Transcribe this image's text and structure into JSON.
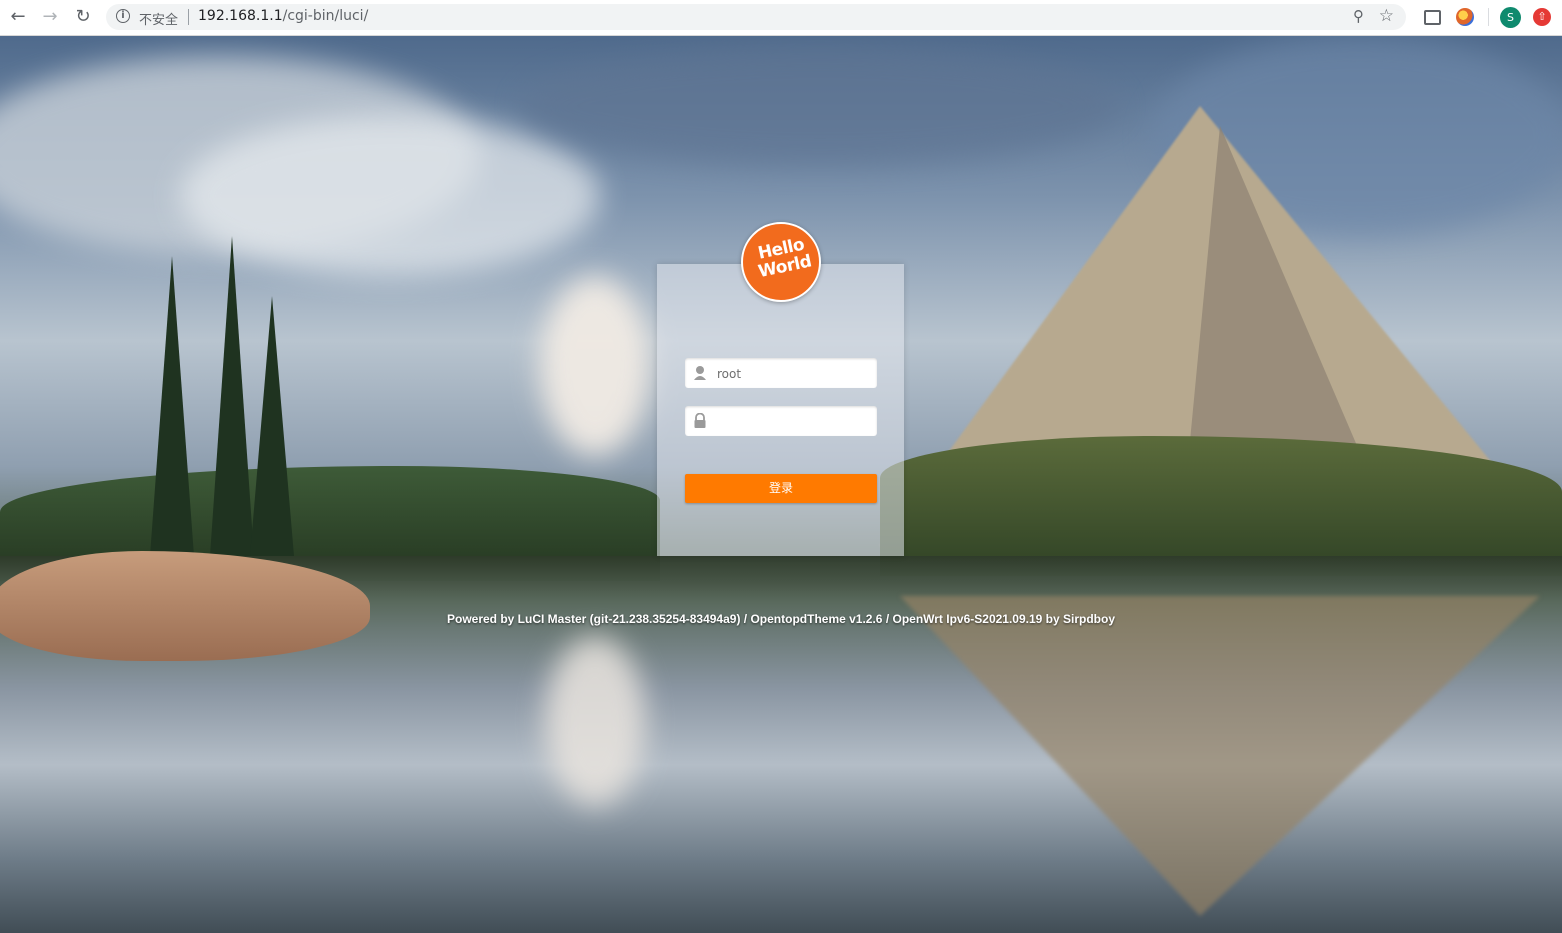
{
  "browser": {
    "security_label": "不安全",
    "url_host": "192.168.1.1",
    "url_path": "/cgi-bin/luci/",
    "profile_initial": "S"
  },
  "icons": {
    "back": "back-arrow-icon",
    "forward": "forward-arrow-icon",
    "reload": "reload-icon",
    "info": "info-icon",
    "zoom": "zoom-icon",
    "star": "bookmark-star-icon"
  },
  "logo": {
    "line1": "Hello",
    "line2": "World"
  },
  "login": {
    "username_value": "root",
    "password_value": "",
    "submit_label": "登录"
  },
  "footer": {
    "text": "Powered by LuCI Master (git-21.238.35254-83494a9) / OpentopdTheme v1.2.6 / OpenWrt Ipv6-S2021.09.19 by Sirpdboy"
  },
  "colors": {
    "accent": "#ff7a00",
    "logo_bg": "#f26b1d",
    "avatar_bg": "#0f8a6e"
  }
}
